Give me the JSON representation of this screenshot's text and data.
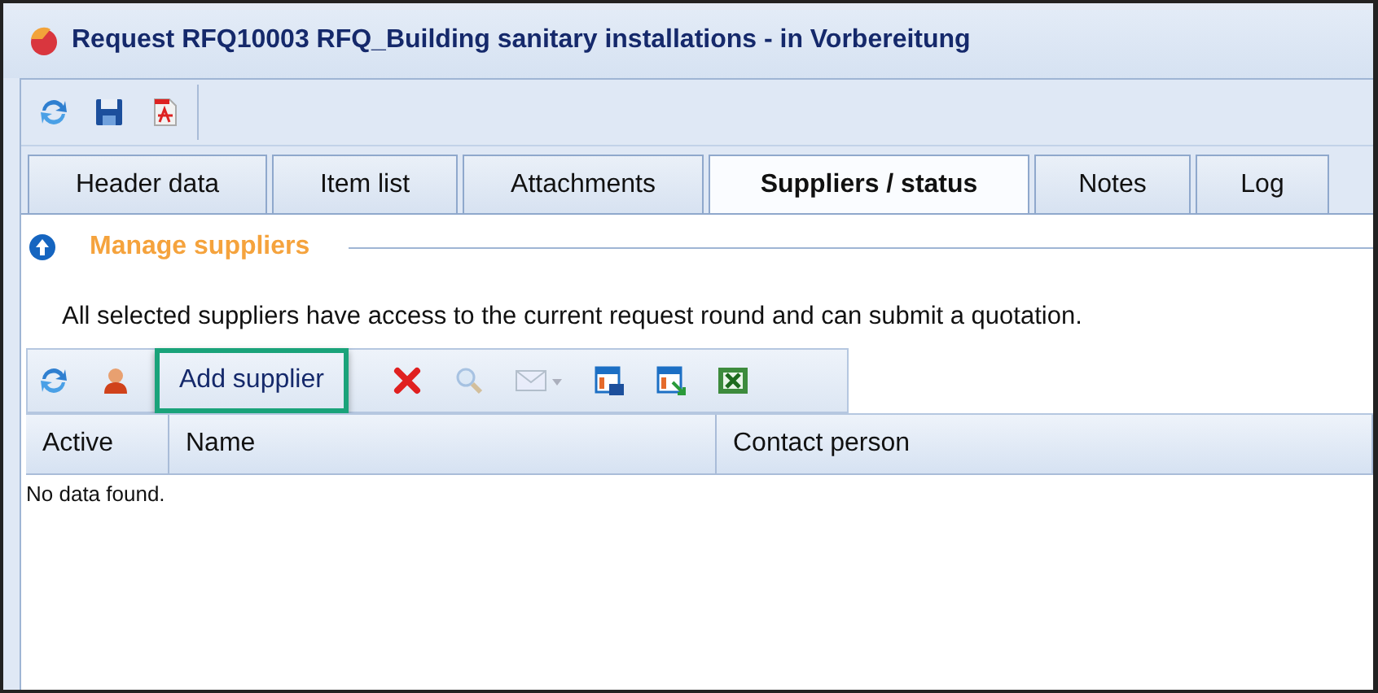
{
  "window": {
    "title": "Request RFQ10003 RFQ_Building sanitary installations - in Vorbereitung"
  },
  "toolbar": [
    {
      "kind": "refresh"
    },
    {
      "kind": "save"
    },
    {
      "kind": "pdf"
    }
  ],
  "tabs": [
    {
      "label": "Header data",
      "selected": false
    },
    {
      "label": "Item list",
      "selected": false
    },
    {
      "label": "Attachments",
      "selected": false
    },
    {
      "label": "Suppliers / status",
      "selected": true
    },
    {
      "label": "Notes",
      "selected": false
    },
    {
      "label": "Log",
      "selected": false
    }
  ],
  "section": {
    "title": "Manage suppliers",
    "expanded": true
  },
  "info": "All selected suppliers have access to the current request round and can submit a quotation.",
  "grid_toolbar": [
    {
      "kind": "refresh",
      "disabled": false
    },
    {
      "kind": "person",
      "disabled": false
    },
    {
      "kind": "text",
      "label": "Add supplier",
      "disabled": false,
      "highlighted": true
    },
    {
      "kind": "delete",
      "disabled": false
    },
    {
      "kind": "search",
      "disabled": true
    },
    {
      "kind": "mail",
      "disabled": true
    },
    {
      "kind": "export",
      "disabled": false
    },
    {
      "kind": "import",
      "disabled": false
    },
    {
      "kind": "excel",
      "disabled": false
    }
  ],
  "table": {
    "columns": [
      "Active",
      "Name",
      "Contact person"
    ],
    "empty_text": "No data found."
  }
}
